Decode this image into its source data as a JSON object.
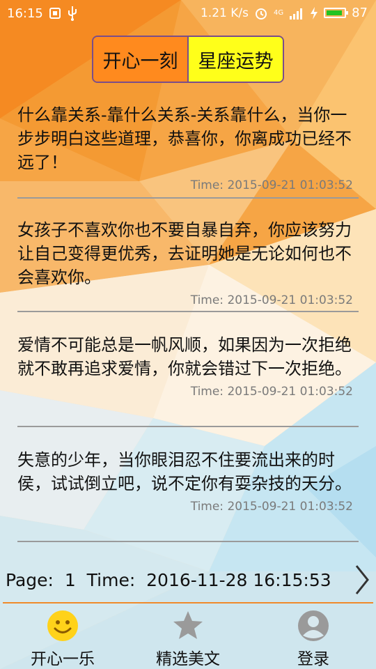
{
  "status_bar": {
    "time": "16:15",
    "network_speed": "1.21 K/s",
    "signal": "4G",
    "battery_level": "87",
    "battery_color": "#22c322"
  },
  "tabs": [
    {
      "label": "开心一刻",
      "active": true
    },
    {
      "label": "星座运势",
      "active": false
    }
  ],
  "posts": [
    {
      "text": "什么靠关系-靠什么关系-关系靠什么，当你一步步明白这些道理，恭喜你，你离成功已经不远了！",
      "time": "Time: 2015-09-21 01:03:52"
    },
    {
      "text": "女孩子不喜欢你也不要自暴自弃，你应该努力让自己变得更优秀，去证明她是无论如何也不会喜欢你。",
      "time": "Time: 2015-09-21 01:03:52"
    },
    {
      "text": "爱情不可能总是一帆风顺，如果因为一次拒绝就不敢再追求爱情，你就会错过下一次拒绝。",
      "time": "Time: 2015-09-21 01:03:52"
    },
    {
      "text": "失意的少年，当你眼泪忍不住要流出来的时侯，试试倒立吧，说不定你有耍杂技的天分。",
      "time": "Time: 2015-09-21 01:03:52"
    }
  ],
  "pager": {
    "text": "Page:  1  Time:  2016-11-28 16:15:53"
  },
  "bottom_nav": [
    {
      "label": "开心一乐",
      "icon": "smiley-icon",
      "active": true
    },
    {
      "label": "精选美文",
      "icon": "star-icon",
      "active": false
    },
    {
      "label": "登录",
      "icon": "user-icon",
      "active": false
    }
  ],
  "colors": {
    "accent_orange": "#ff8a1e",
    "accent_yellow": "#ffff1a",
    "separator": "#f08a2a"
  }
}
